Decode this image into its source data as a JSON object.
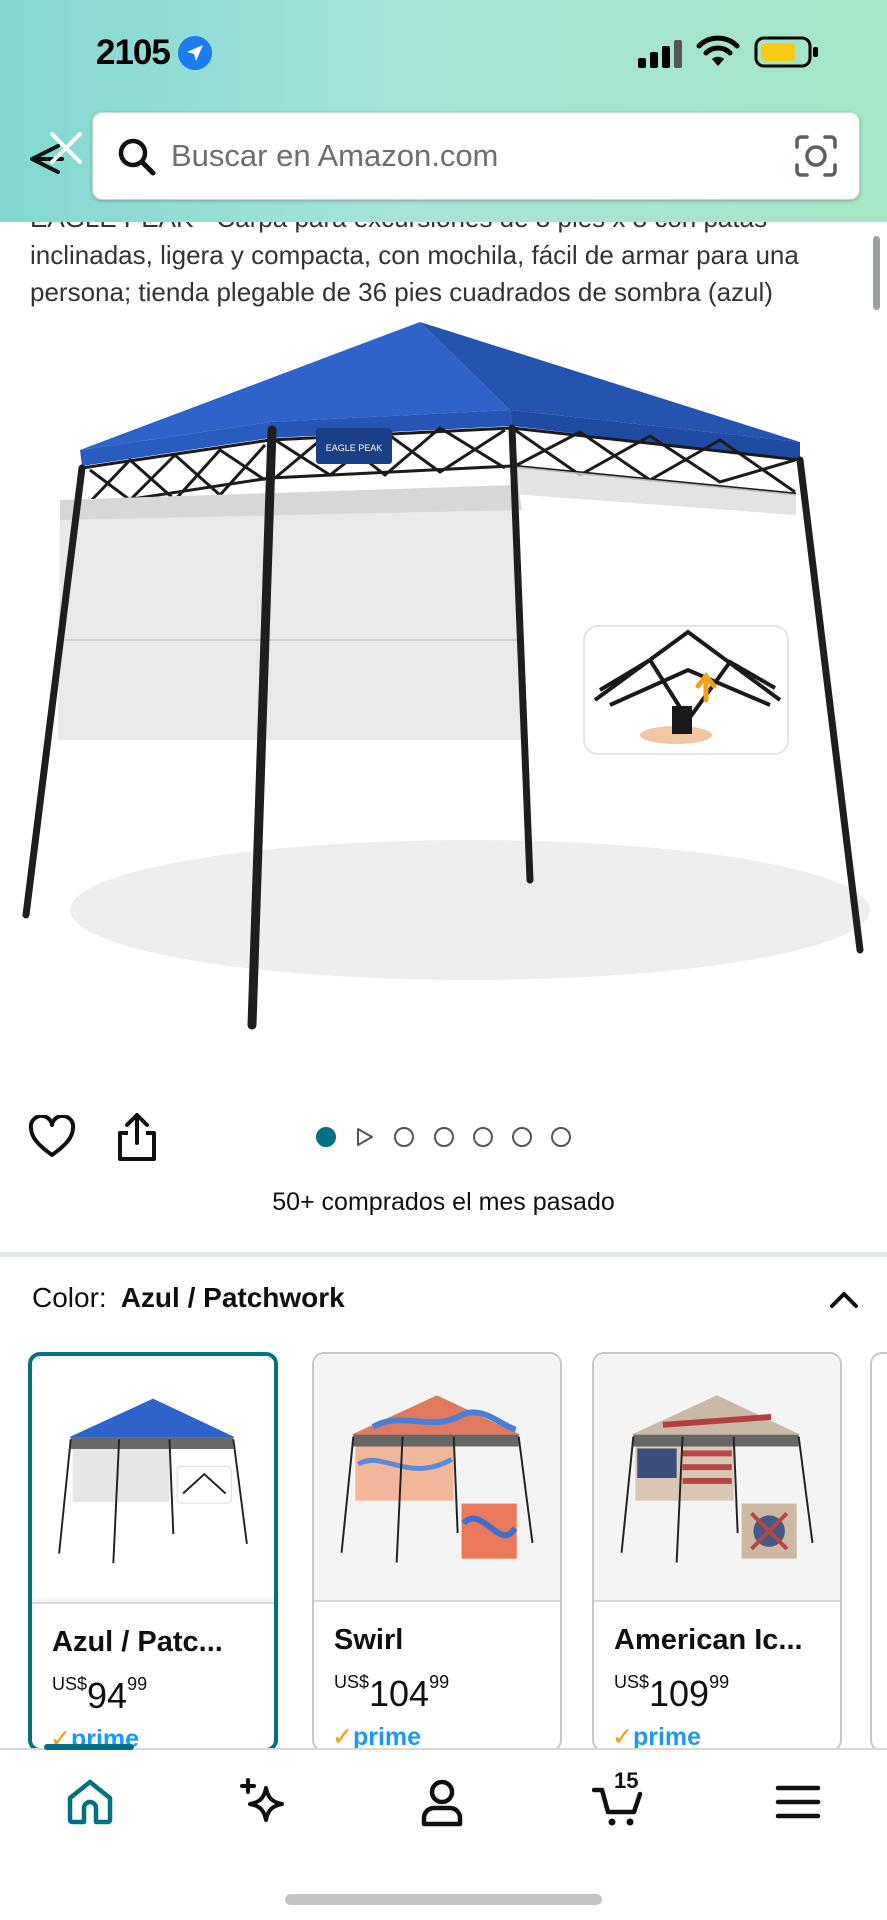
{
  "status_bar": {
    "time": "21:05",
    "time_display": "2105"
  },
  "search": {
    "placeholder": "Buscar en Amazon.com"
  },
  "product": {
    "title": "EAGLE PEAK - Carpa para excursiones de 8 pies x 8 con patas inclinadas, ligera y compacta, con mochila, fácil de armar para una persona; tienda plegable de 36 pies cuadrados de sombra (azul)",
    "image_description": "blue canopy tent with sidewall",
    "image_badge_text": "EAGLE PEAK",
    "carousel": {
      "total": 7,
      "active_index": 0
    },
    "purchased_text": "50+ comprados el mes pasado"
  },
  "color_selector": {
    "label": "Color:",
    "value": "Azul / Patchwork",
    "options": [
      {
        "name": "Azul / Patc...",
        "currency": "US$",
        "whole": "94",
        "fraction": "99",
        "prime": "prime",
        "selected": true
      },
      {
        "name": "Swirl",
        "currency": "US$",
        "whole": "104",
        "fraction": "99",
        "prime": "prime",
        "selected": false
      },
      {
        "name": "American Ic...",
        "currency": "US$",
        "whole": "109",
        "fraction": "99",
        "prime": "prime",
        "selected": false
      }
    ]
  },
  "bottom_nav": {
    "items": [
      "home-icon",
      "rufus-sparkle-icon",
      "account-icon",
      "cart-icon",
      "menu-icon"
    ],
    "cart_count": "15"
  },
  "colors": {
    "accent": "#007185",
    "header_gradient_start": "#81d8d0",
    "header_gradient_end": "#a5e6c6",
    "prime_blue": "#1a98ff",
    "prime_check": "#ff9900",
    "canopy_blue": "#2f63c9"
  }
}
